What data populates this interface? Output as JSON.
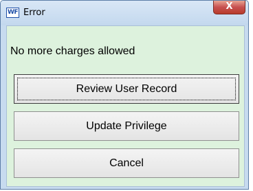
{
  "window": {
    "app_icon_text": "WF",
    "title": "Error",
    "close_symbol": "X"
  },
  "dialog": {
    "message": "No more charges allowed",
    "buttons": {
      "review_label": "Review User Record",
      "update_label": "Update Privilege",
      "cancel_label": "Cancel"
    }
  },
  "colors": {
    "client_background": "#ddf2dd",
    "frame": "#c7dbef",
    "close_button": "#c75050"
  },
  "icons": {
    "app": "wf-app-icon",
    "close": "close-icon"
  }
}
